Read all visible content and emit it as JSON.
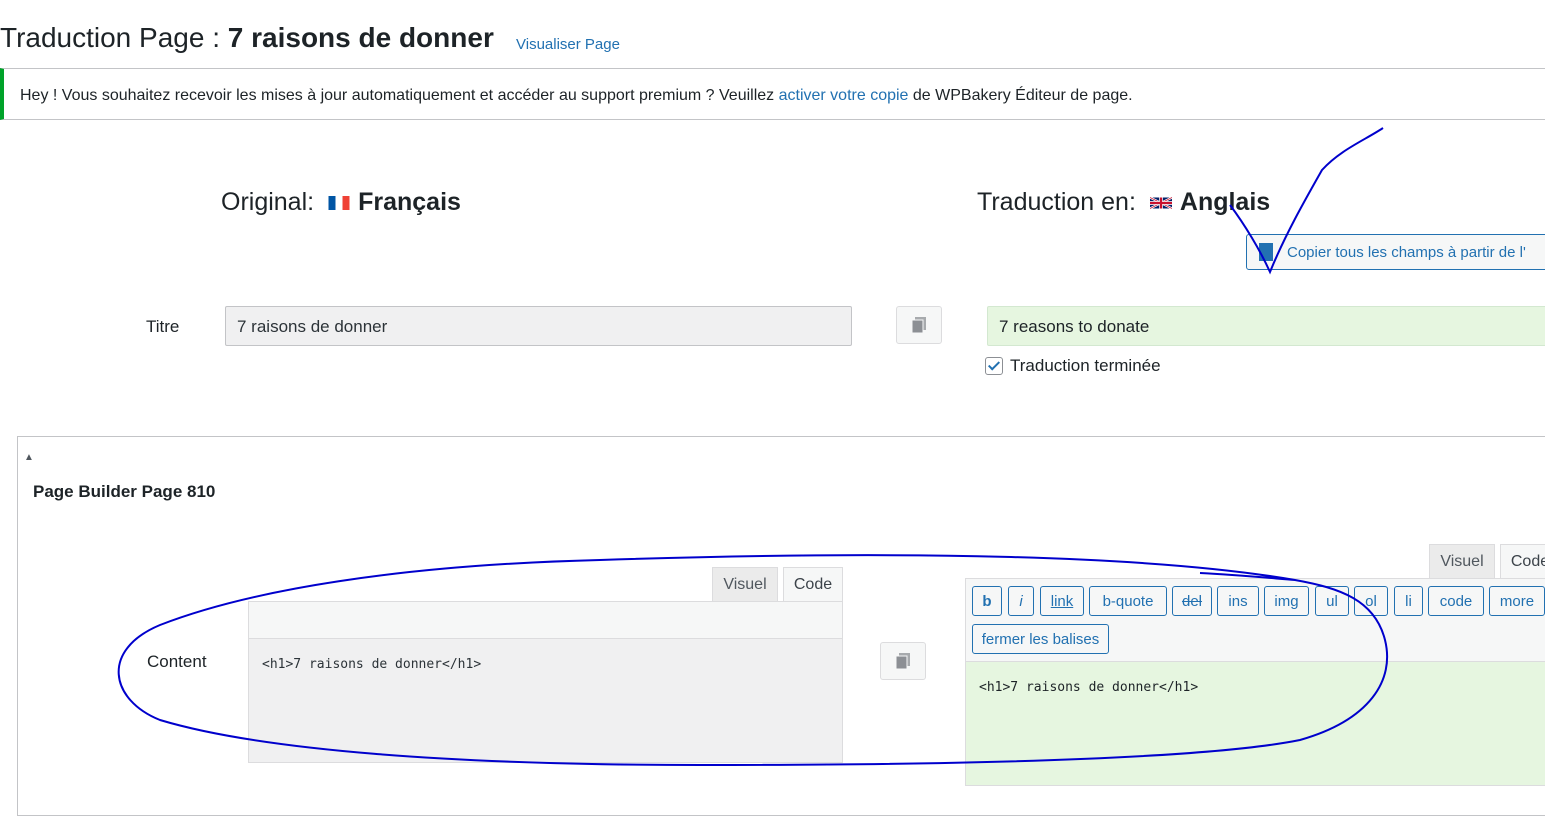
{
  "header": {
    "title_prefix": "Traduction Page : ",
    "title_name": "7 raisons de donner",
    "view_link": "Visualiser Page"
  },
  "notice": {
    "text_before": "Hey ! Vous souhaitez recevoir les mises à jour automatiquement et accéder au support premium ? Veuillez ",
    "link": "activer votre copie",
    "text_after": " de WPBakery Éditeur de page.",
    "border_color": "#00a32a"
  },
  "original": {
    "label": "Original:",
    "language": "Français",
    "flag": "fr-flag-icon"
  },
  "translation": {
    "label": "Traduction en:",
    "language": "Anglais",
    "flag": "uk-flag-icon",
    "copy_all_label": "Copier tous les champs à partir de l'"
  },
  "title_row": {
    "label": "Titre",
    "original_value": "7 raisons de donner",
    "translated_value": "7 reasons to donate",
    "done_label": "Traduction terminée",
    "done_checked": true
  },
  "page_builder": {
    "toggle": "▲",
    "title": "Page Builder Page 810",
    "content_label": "Content",
    "tabs": {
      "visual": "Visuel",
      "code": "Code"
    },
    "original_content": "<h1>7 raisons de donner</h1>",
    "translated_content": "<h1>7 raisons de donner</h1>",
    "quicktags": [
      "b",
      "i",
      "link",
      "b-quote",
      "del",
      "ins",
      "img",
      "ul",
      "ol",
      "li",
      "code",
      "more"
    ],
    "close_tags": "fermer les balises"
  },
  "colors": {
    "accent": "#2271b1",
    "translated_bg": "#e6f6e0",
    "annotation": "#0000cc"
  }
}
